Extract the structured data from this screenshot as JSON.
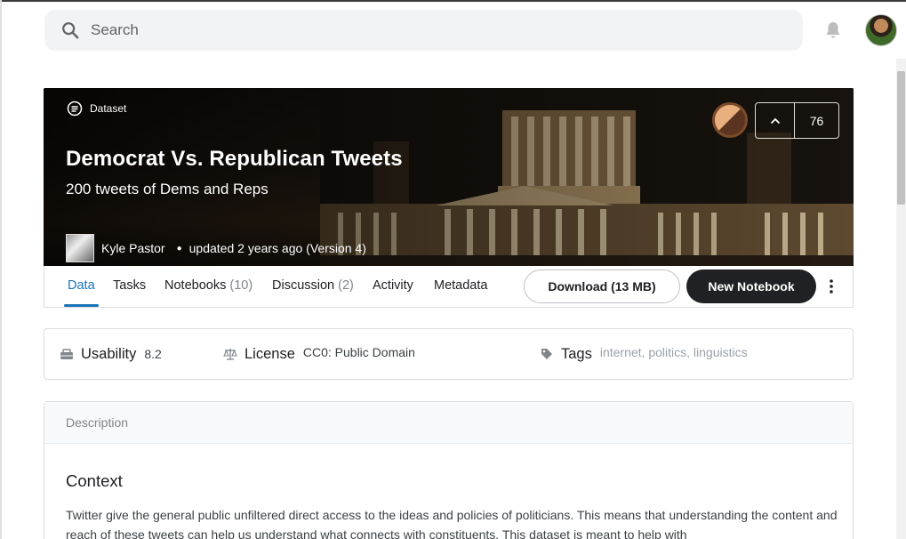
{
  "search": {
    "placeholder": "Search"
  },
  "icons": {
    "search": "search-icon",
    "notifications": "bell-icon",
    "dataset": "dataset-icon",
    "upvote": "chevron-up-icon",
    "more": "more-vert-icon",
    "usability": "usability-icon",
    "license": "scale-icon",
    "tags": "tag-icon"
  },
  "hero": {
    "badge": "Dataset",
    "title": "Democrat Vs. Republican Tweets",
    "subtitle": "200 tweets of Dems and Reps",
    "author": "Kyle Pastor",
    "updated": "updated 2 years ago (Version 4)",
    "votes": "76"
  },
  "tabs": [
    {
      "label": "Data",
      "count": ""
    },
    {
      "label": "Tasks",
      "count": ""
    },
    {
      "label": "Notebooks",
      "count": "(10)"
    },
    {
      "label": "Discussion",
      "count": "(2)"
    },
    {
      "label": "Activity",
      "count": ""
    },
    {
      "label": "Metadata",
      "count": ""
    }
  ],
  "actions": {
    "download": "Download (13 MB)",
    "new_notebook": "New Notebook"
  },
  "meta": {
    "usability_label": "Usability",
    "usability_value": "8.2",
    "license_label": "License",
    "license_value": "CC0: Public Domain",
    "tags_label": "Tags",
    "tags": [
      "internet",
      "politics",
      "linguistics"
    ],
    "tags_text": "internet, politics, linguistics"
  },
  "description": {
    "header": "Description",
    "heading": "Context",
    "body": "Twitter give the general public unfiltered direct access to the ideas and policies of politicians. This means that understanding the content and reach of these tweets can help us understand what connects with constituents. This dataset is meant to help with"
  },
  "colors": {
    "accent": "#1a73b8",
    "dark_button": "#202124",
    "search_bg": "#f1f3f4"
  }
}
